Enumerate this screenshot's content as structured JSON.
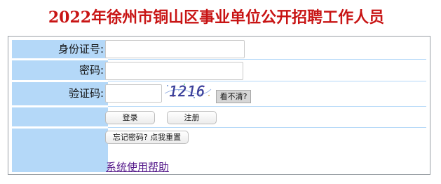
{
  "title": "2022年徐州市铜山区事业单位公开招聘工作人员",
  "form": {
    "id_label": "身份证号:",
    "id_value": "",
    "password_label": "密码:",
    "password_value": "",
    "captcha_label": "验证码:",
    "captcha_value": "",
    "captcha_text": "1216",
    "refresh_label": "看不清?",
    "login_label": "登录",
    "register_label": "注册",
    "forgot_label": "忘记密码? 点我重置",
    "help_label": "系统使用帮助"
  },
  "colors": {
    "title": "#c81414",
    "label_bg": "#b4d8f8",
    "captcha_ink": "#3a3f9a",
    "link": "#551a8b"
  },
  "icons": {
    "captcha": "captcha-image"
  }
}
